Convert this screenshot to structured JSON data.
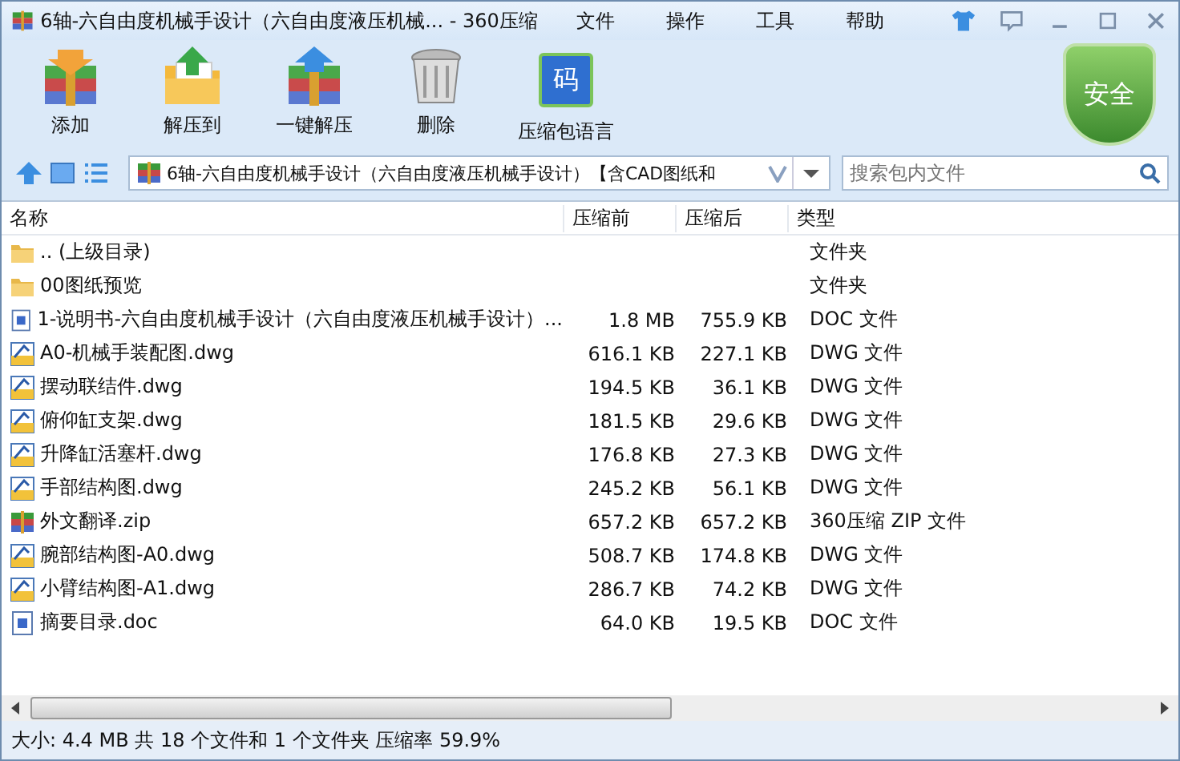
{
  "window": {
    "title": "6轴-六自由度机械手设计（六自由度液压机械... - 360压缩"
  },
  "menu": [
    "文件",
    "操作",
    "工具",
    "帮助"
  ],
  "toolbar": [
    {
      "label": "添加",
      "kind": "add"
    },
    {
      "label": "解压到",
      "kind": "extract"
    },
    {
      "label": "一键解压",
      "kind": "quick"
    },
    {
      "label": "删除",
      "kind": "delete"
    },
    {
      "label": "压缩包语言",
      "kind": "lang",
      "glyph": "码"
    }
  ],
  "security_badge": "安全",
  "address": {
    "value": "6轴-六自由度机械手设计（六自由度液压机械手设计）【含CAD图纸和"
  },
  "search": {
    "placeholder": "搜索包内文件"
  },
  "table": {
    "columns": [
      "名称",
      "压缩前",
      "压缩后",
      "类型"
    ],
    "rows": [
      {
        "kind": "folder",
        "name": ".. (上级目录)",
        "size": "",
        "packed": "",
        "type": "文件夹"
      },
      {
        "kind": "folder",
        "name": "00图纸预览",
        "size": "",
        "packed": "",
        "type": "文件夹"
      },
      {
        "kind": "doc",
        "name": "1-说明书-六自由度机械手设计（六自由度液压机械手设计）...",
        "size": "1.8 MB",
        "packed": "755.9 KB",
        "type": "DOC 文件"
      },
      {
        "kind": "dwg",
        "name": "A0-机械手装配图.dwg",
        "size": "616.1 KB",
        "packed": "227.1 KB",
        "type": "DWG 文件"
      },
      {
        "kind": "dwg",
        "name": "摆动联结件.dwg",
        "size": "194.5 KB",
        "packed": "36.1 KB",
        "type": "DWG 文件"
      },
      {
        "kind": "dwg",
        "name": "俯仰缸支架.dwg",
        "size": "181.5 KB",
        "packed": "29.6 KB",
        "type": "DWG 文件"
      },
      {
        "kind": "dwg",
        "name": "升降缸活塞杆.dwg",
        "size": "176.8 KB",
        "packed": "27.3 KB",
        "type": "DWG 文件"
      },
      {
        "kind": "dwg",
        "name": "手部结构图.dwg",
        "size": "245.2 KB",
        "packed": "56.1 KB",
        "type": "DWG 文件"
      },
      {
        "kind": "zip",
        "name": "外文翻译.zip",
        "size": "657.2 KB",
        "packed": "657.2 KB",
        "type": "360压缩 ZIP 文件"
      },
      {
        "kind": "dwg",
        "name": "腕部结构图-A0.dwg",
        "size": "508.7 KB",
        "packed": "174.8 KB",
        "type": "DWG 文件"
      },
      {
        "kind": "dwg",
        "name": "小臂结构图-A1.dwg",
        "size": "286.7 KB",
        "packed": "74.2 KB",
        "type": "DWG 文件"
      },
      {
        "kind": "doc",
        "name": "摘要目录.doc",
        "size": "64.0 KB",
        "packed": "19.5 KB",
        "type": "DOC 文件"
      }
    ]
  },
  "status_bar": "大小: 4.4 MB 共 18 个文件和 1 个文件夹 压缩率 59.9%"
}
